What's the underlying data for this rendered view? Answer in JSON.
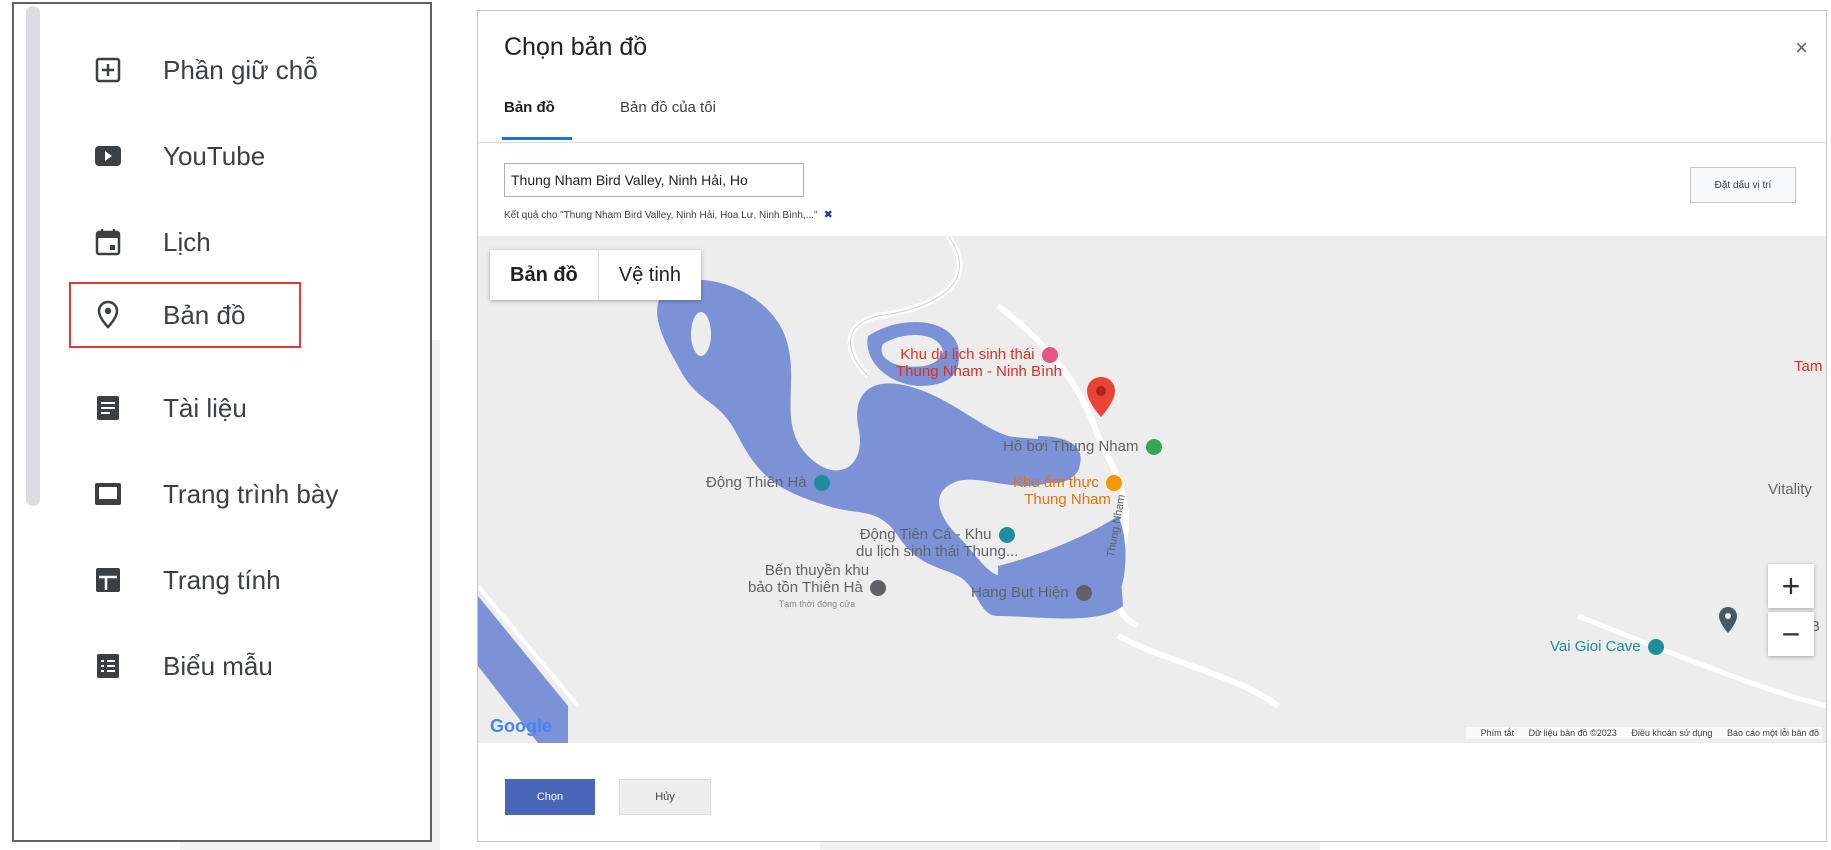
{
  "left_menu": {
    "items": [
      {
        "label": "Phần giữ chỗ",
        "icon": "placeholder-add-icon"
      },
      {
        "label": "YouTube",
        "icon": "youtube-icon"
      },
      {
        "label": "Lịch",
        "icon": "calendar-icon"
      },
      {
        "label": "Bản đồ",
        "icon": "map-pin-icon",
        "highlighted": true
      },
      {
        "label": "Tài liệu",
        "icon": "docs-icon"
      },
      {
        "label": "Trang trình bày",
        "icon": "slides-icon"
      },
      {
        "label": "Trang tính",
        "icon": "sheets-icon"
      },
      {
        "label": "Biểu mẫu",
        "icon": "forms-icon"
      }
    ]
  },
  "dialog": {
    "title": "Chọn bản đồ",
    "close": "×",
    "tabs": [
      {
        "label": "Bản đồ",
        "active": true
      },
      {
        "label": "Bản đồ của tôi",
        "active": false
      }
    ],
    "search": {
      "value": "Thung Nham Bird Valley, Ninh Hải, Ho",
      "result_text": "Kết quả cho \"Thung Nham Bird Valley, Ninh Hải, Hoa Lư, Ninh Bình,...\"",
      "clear": "✖"
    },
    "pin_button": "Đặt dấu vị trí",
    "map": {
      "type_buttons": [
        "Bản đồ",
        "Vệ tinh"
      ],
      "pois": {
        "eco_line1": "Khu du lịch sinh thái",
        "eco_line2": "Thung Nham - Ninh Bình",
        "pool": "Hồ bơi Thung Nham",
        "food_line1": "Khu ẩm thực",
        "food_line2": "Thung Nham",
        "thien_ha": "Động Thiên Hà",
        "tien_ca_line1": "Động Tiên Cá - Khu",
        "tien_ca_line2": "du lịch sinh thái Thung...",
        "ben_line1": "Bến thuyền khu",
        "ben_line2": "bảo tồn Thiên Hà",
        "ben_status": "Tạm thời đóng cửa",
        "hang_but": "Hang Bụt Hiện",
        "road": "Thung Nham",
        "tam": "Tam",
        "vitality": "Vitality",
        "vai_gioi": "Vai Gioi Cave",
        "b_right": "B",
        "google": "Google"
      },
      "zoom_in": "+",
      "zoom_out": "−",
      "attribution": [
        "Phím tắt",
        "Dữ liệu bản đồ ©2023",
        "Điều khoản sử dụng",
        "Báo cáo một lỗi bản đồ"
      ]
    },
    "buttons": {
      "choose": "Chọn",
      "cancel": "Hủy"
    }
  },
  "colors": {
    "water": "#7b93d6",
    "selection_box": "#e53935",
    "primary_button": "#4a66b8",
    "tab_underline": "#1a73e8"
  }
}
